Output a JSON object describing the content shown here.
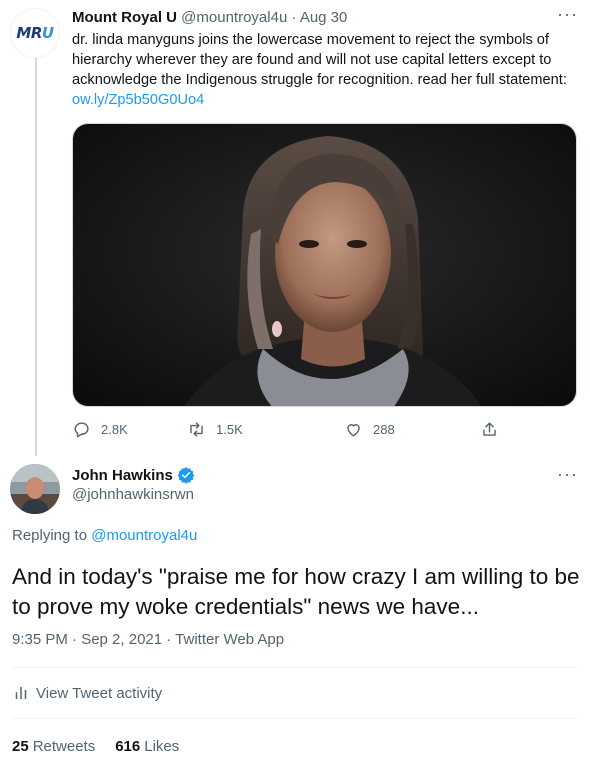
{
  "tweet1": {
    "avatar_text_primary": "MR",
    "avatar_text_accent": "U",
    "name": "Mount Royal U",
    "handle": "@mountroyal4u",
    "separator": "·",
    "date": "Aug 30",
    "more": "···",
    "text": "dr. linda manyguns joins the lowercase movement to reject the symbols of hierarchy wherever they are found and will not use capital letters except to acknowledge the Indigenous struggle for recognition. read her full statement: ",
    "link": "ow.ly/Zp5b50G0Uo4",
    "replies": "2.8K",
    "retweets": "1.5K",
    "likes": "288",
    "icons": [
      "reply-icon",
      "retweet-icon",
      "like-icon",
      "share-icon"
    ]
  },
  "tweet2": {
    "name": "John Hawkins",
    "handle": "@johnhawkinsrwn",
    "more": "···",
    "replying_prefix": "Replying to ",
    "replying_to": "@mountroyal4u",
    "text": "And in today's \"praise me for how crazy I am willing to be to prove my woke credentials\" news we have...",
    "timestamp": "9:35 PM · Sep 2, 2021 · Twitter Web App",
    "activity_label": "View Tweet activity",
    "retweets_count": "25",
    "retweets_label": "Retweets",
    "likes_count": "616",
    "likes_label": "Likes"
  },
  "colors": {
    "link": "#1d9bf0",
    "secondary_text": "#536471",
    "verified": "#1d9bf0"
  }
}
